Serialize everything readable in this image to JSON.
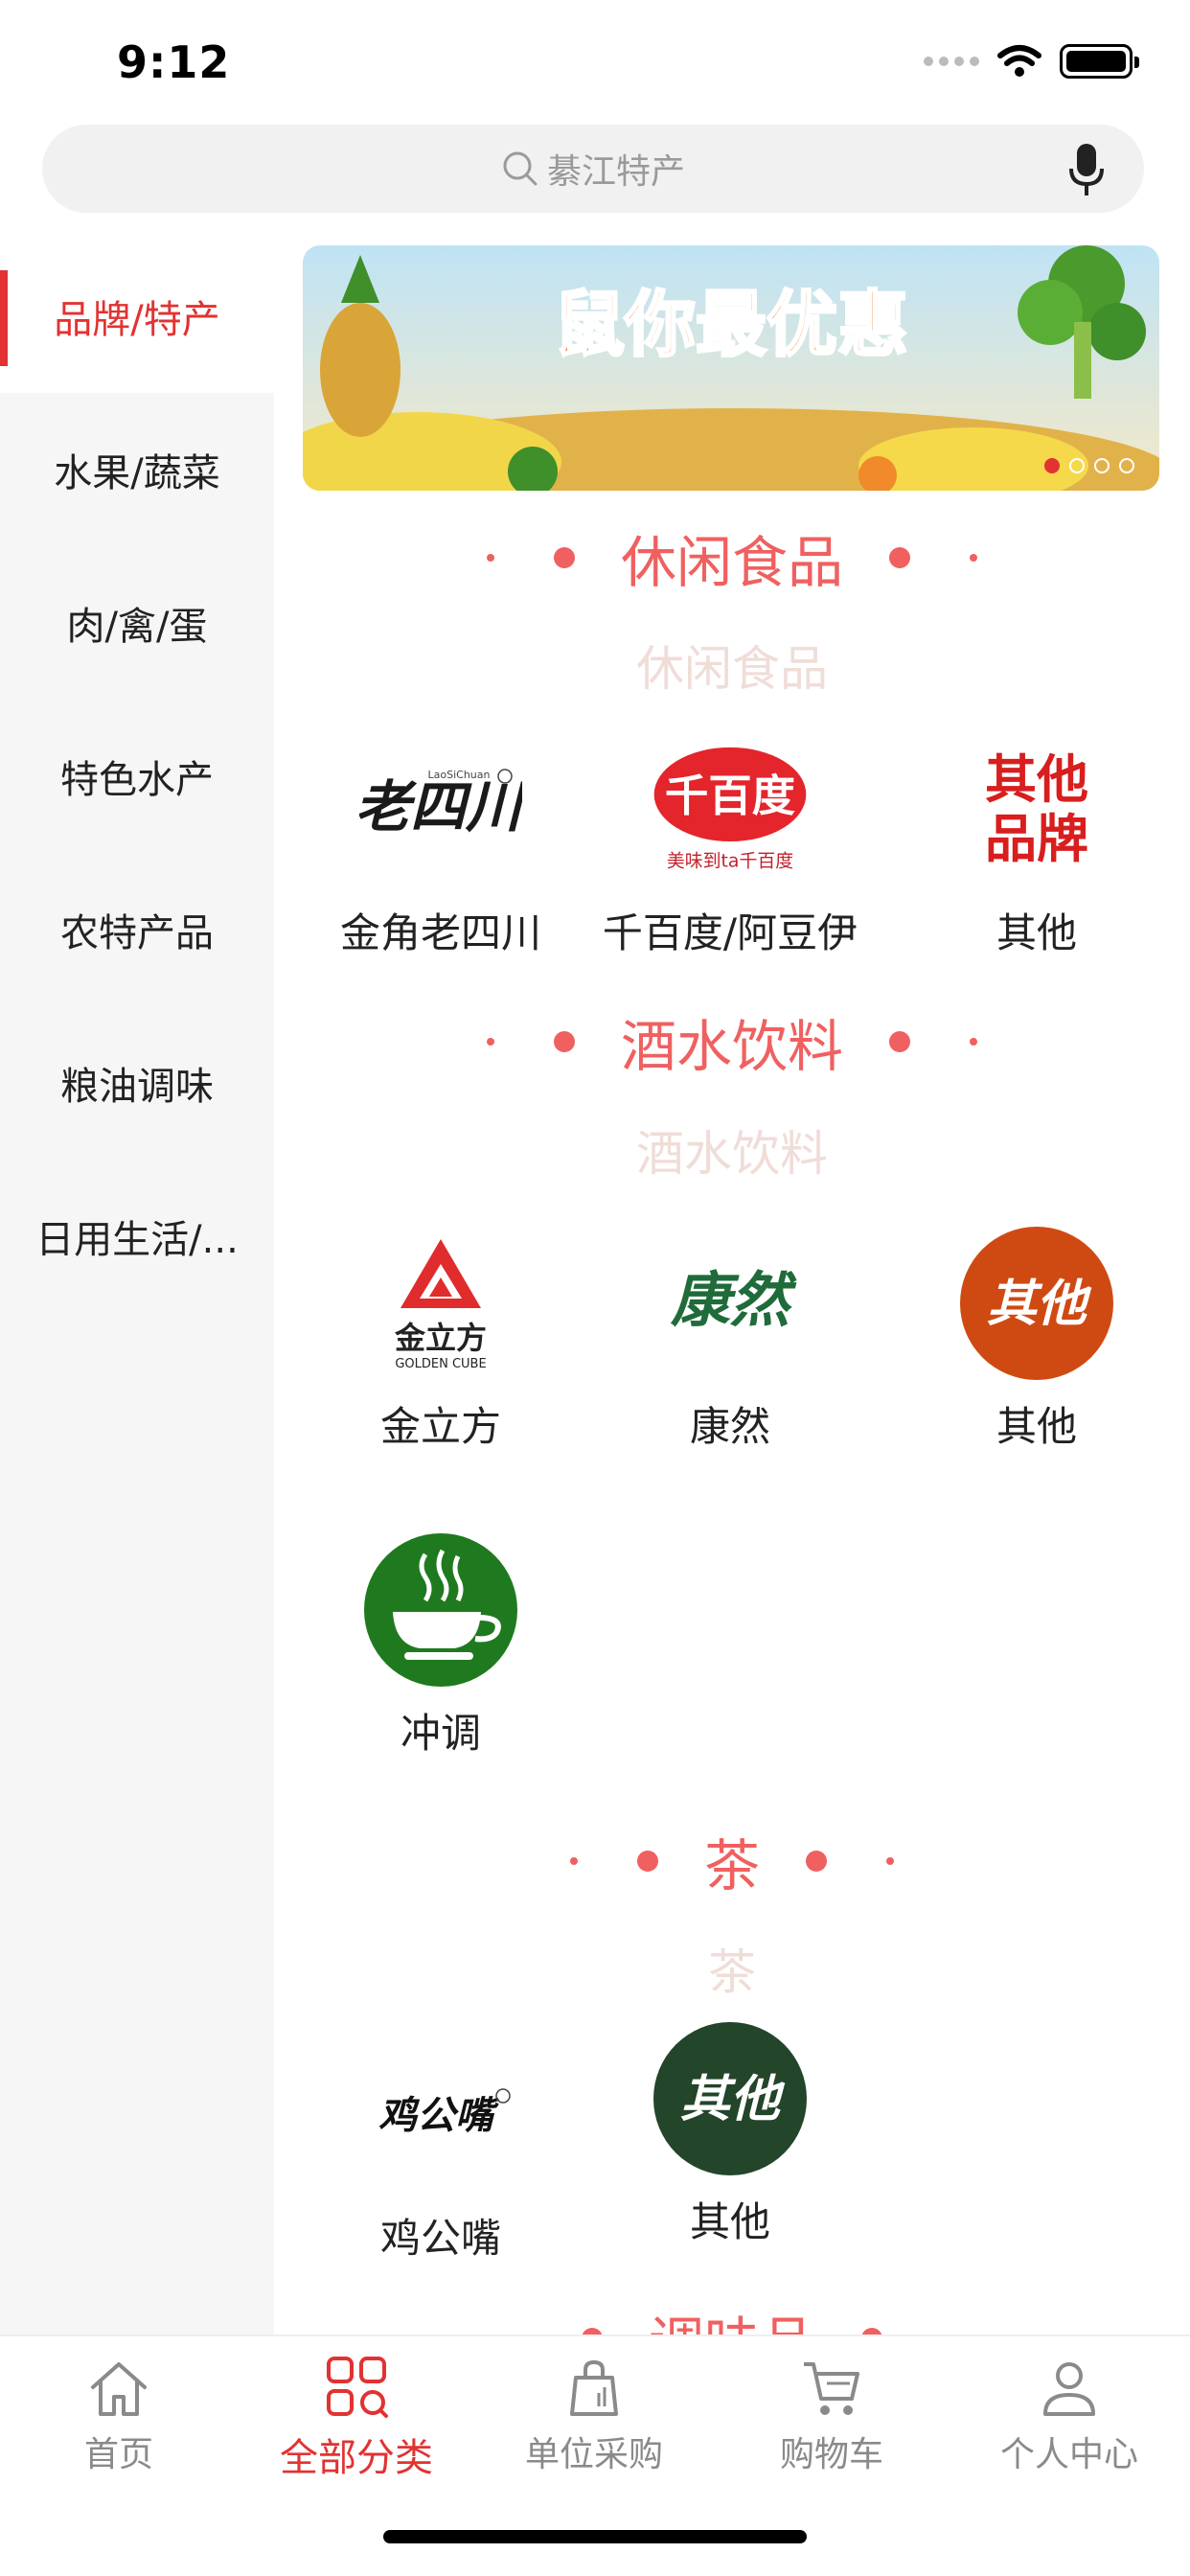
{
  "status": {
    "time": "9:12"
  },
  "search": {
    "placeholder": "綦江特产"
  },
  "sidebar": {
    "items": [
      {
        "label": "品牌/特产",
        "active": true
      },
      {
        "label": "水果/蔬菜"
      },
      {
        "label": "肉/禽/蛋"
      },
      {
        "label": "特色水产"
      },
      {
        "label": "农特产品"
      },
      {
        "label": "粮油调味"
      },
      {
        "label": "日用生活/..."
      }
    ]
  },
  "banner": {
    "text": "鼠你最优惠",
    "page_count": 4,
    "active_index": 0
  },
  "sections": [
    {
      "title": "休闲食品",
      "subtitle": "休闲食品",
      "brands": [
        {
          "name": "金角老四川",
          "logo_text": "老四川",
          "logo_sub": "LaoSiChuan"
        },
        {
          "name": "千百度/阿豆伊",
          "logo_text": "千百度",
          "logo_sub": "美味到ta千百度"
        },
        {
          "name": "其他",
          "logo_text": "其他品牌"
        }
      ]
    },
    {
      "title": "酒水饮料",
      "subtitle": "酒水饮料",
      "brands": [
        {
          "name": "金立方",
          "logo_text": "金立方",
          "logo_sub": "GOLDEN CUBE"
        },
        {
          "name": "康然",
          "logo_text": "康然"
        },
        {
          "name": "其他",
          "logo_text": "其他"
        },
        {
          "name": "冲调",
          "logo_text": ""
        }
      ]
    },
    {
      "title": "茶",
      "subtitle": "茶",
      "brands": [
        {
          "name": "鸡公嘴",
          "logo_text": "鸡公嘴"
        },
        {
          "name": "其他",
          "logo_text": "其他"
        }
      ]
    },
    {
      "title": "调味品"
    }
  ],
  "tabbar": {
    "items": [
      {
        "label": "首页",
        "icon": "home-icon"
      },
      {
        "label": "全部分类",
        "icon": "category-icon",
        "active": true
      },
      {
        "label": "单位采购",
        "icon": "purchase-bag-icon"
      },
      {
        "label": "购物车",
        "icon": "cart-icon"
      },
      {
        "label": "个人中心",
        "icon": "user-icon"
      }
    ]
  },
  "colors": {
    "accent": "#e23232",
    "section_title": "#f06060",
    "subtitle": "#f0ddd8",
    "sidebar_bg": "#f6f6f6"
  }
}
